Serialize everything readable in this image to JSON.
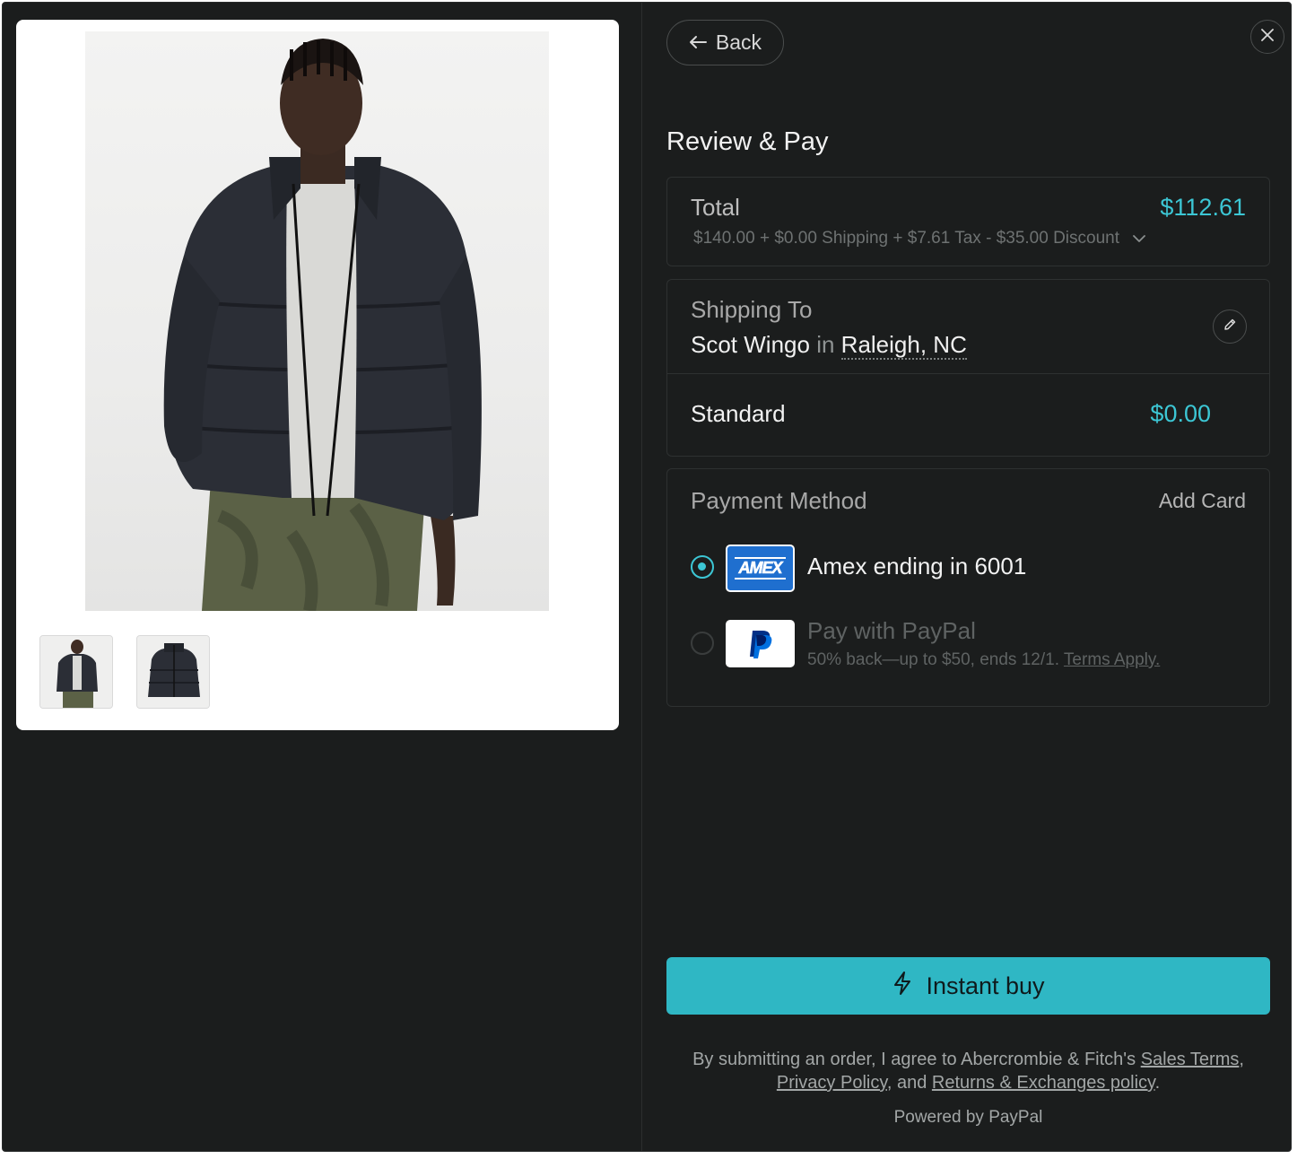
{
  "back": {
    "label": "Back"
  },
  "review": {
    "title": "Review & Pay"
  },
  "total": {
    "label": "Total",
    "value": "$112.61",
    "breakdown": "$140.00 + $0.00 Shipping + $7.61 Tax - $35.00 Discount"
  },
  "shipping": {
    "label": "Shipping To",
    "name": "Scot Wingo",
    "connector": "in",
    "city": "Raleigh, NC",
    "method": "Standard",
    "method_price": "$0.00"
  },
  "payment": {
    "label": "Payment Method",
    "add_card": "Add Card",
    "options": [
      {
        "label": "Amex ending in 6001",
        "logo_text": "AMEX",
        "selected": true
      },
      {
        "label": "Pay with PayPal",
        "subtext": "50% back—up to $50, ends 12/1.",
        "link": "Terms Apply.",
        "selected": false
      }
    ]
  },
  "buy": {
    "label": "Instant buy"
  },
  "legal": {
    "prefix": "By submitting an order, I agree to Abercrombie & Fitch's",
    "sales_terms": "Sales Terms",
    "comma": ",",
    "privacy": "Privacy Policy",
    "and": ", and",
    "returns": "Returns & Exchanges policy",
    "period": "."
  },
  "powered_by": "Powered by PayPal",
  "colors": {
    "accent": "#3cc6d4",
    "button": "#2fb7c4",
    "background": "#1b1d1d",
    "amex_blue": "#1f6fcf"
  },
  "icons": [
    "arrow-left-icon",
    "close-icon",
    "chevron-down-icon",
    "pencil-icon",
    "lightning-icon",
    "paypal-logo",
    "amex-logo"
  ]
}
